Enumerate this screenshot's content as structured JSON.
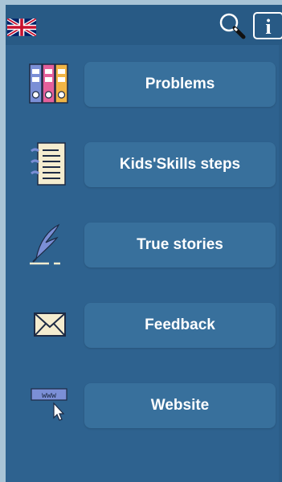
{
  "header": {
    "flag_icon": "uk-flag-icon",
    "search_icon": "magnifier-icon",
    "info_icon": "info-icon"
  },
  "menu": [
    {
      "label": "Problems",
      "icon": "binders-icon"
    },
    {
      "label": "Kids'Skills steps",
      "icon": "notepad-icon"
    },
    {
      "label": "True stories",
      "icon": "quill-icon"
    },
    {
      "label": "Feedback",
      "icon": "envelope-icon"
    },
    {
      "label": "Website",
      "icon": "www-cursor-icon"
    }
  ],
  "colors": {
    "background": "#2e628f",
    "button": "#38709c",
    "button_text": "#ffffff"
  }
}
